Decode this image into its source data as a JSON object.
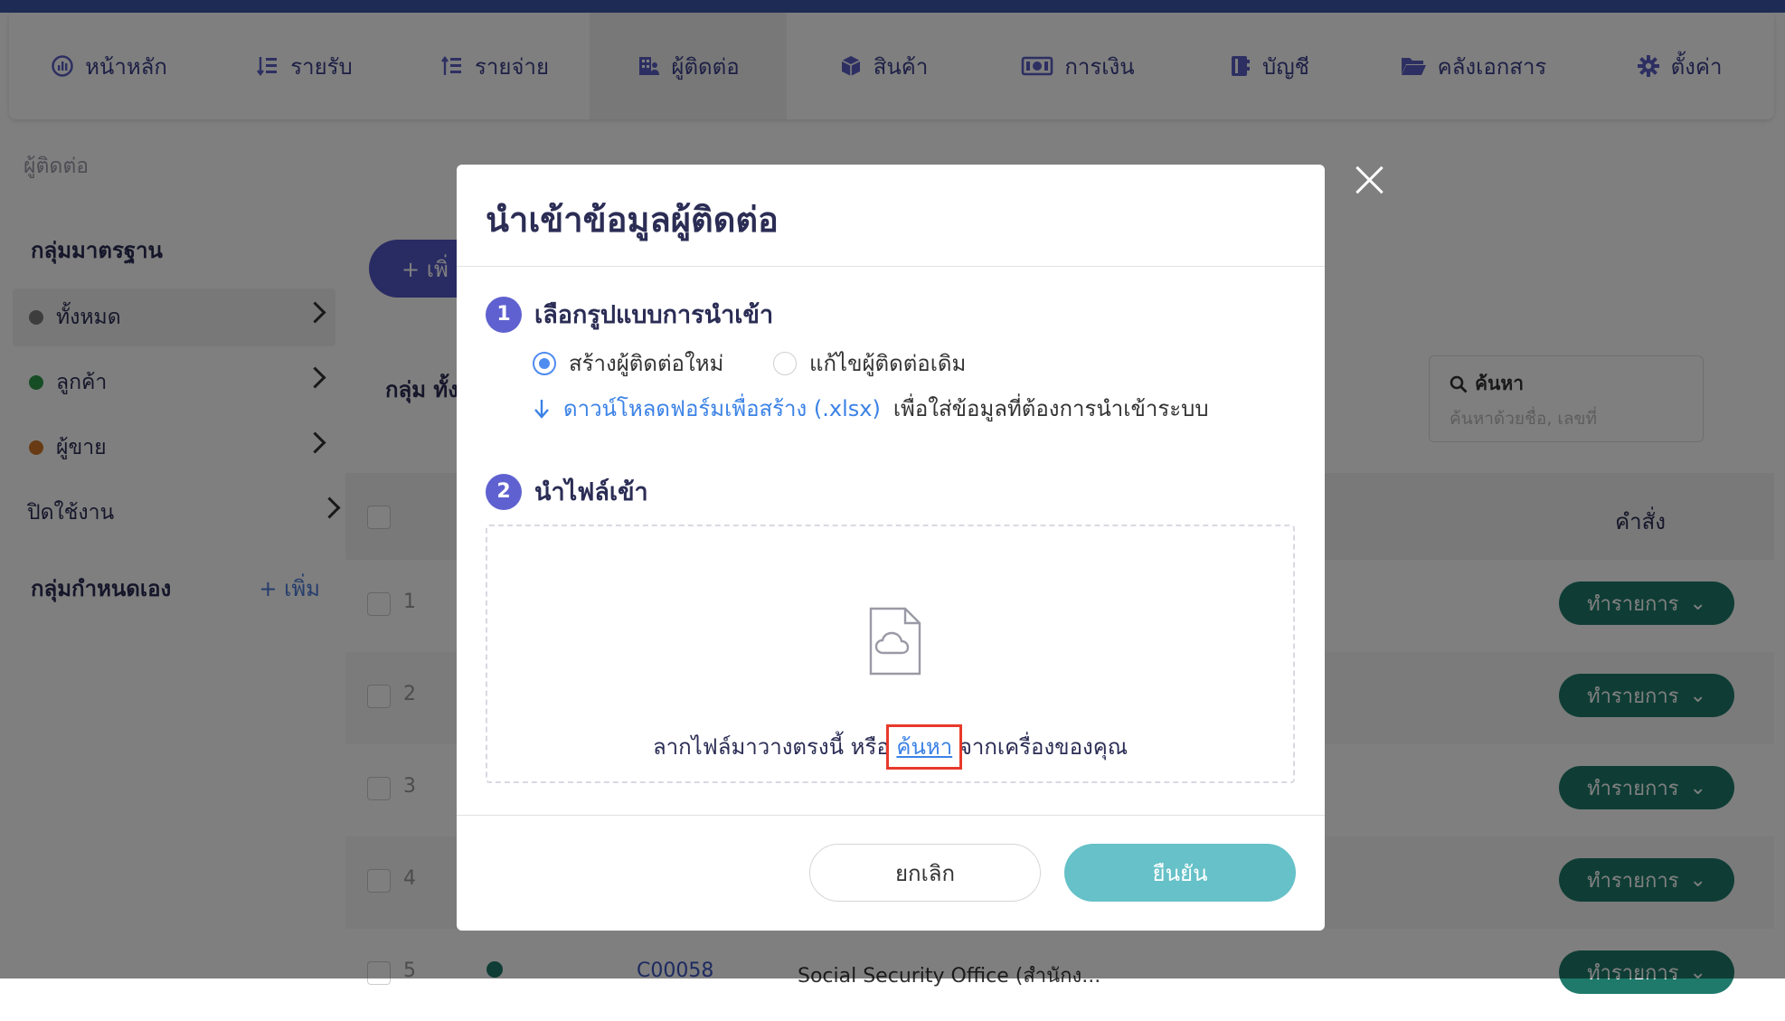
{
  "nav": {
    "items": [
      {
        "label": "หน้าหลัก",
        "icon": "dashboard-icon"
      },
      {
        "label": "รายรับ",
        "icon": "income-icon"
      },
      {
        "label": "รายจ่าย",
        "icon": "expense-icon"
      },
      {
        "label": "ผู้ติดต่อ",
        "icon": "contacts-icon"
      },
      {
        "label": "สินค้า",
        "icon": "box-icon"
      },
      {
        "label": "การเงิน",
        "icon": "money-icon"
      },
      {
        "label": "บัญชี",
        "icon": "ledger-icon"
      },
      {
        "label": "คลังเอกสาร",
        "icon": "folder-icon"
      },
      {
        "label": "ตั้งค่า",
        "icon": "gear-icon"
      }
    ],
    "active": "ผู้ติดต่อ"
  },
  "breadcrumb": "ผู้ติดต่อ",
  "sidebar": {
    "standard_title": "กลุ่มมาตรฐาน",
    "items": [
      {
        "label": "ทั้งหมด",
        "dot_color": "#7a7a7a"
      },
      {
        "label": "ลูกค้า",
        "dot_color": "#2e9a4a"
      },
      {
        "label": "ผู้ขาย",
        "dot_color": "#d0772a"
      },
      {
        "label": "ปิดใช้งาน",
        "dot_color": ""
      }
    ],
    "custom_title": "กลุ่มกำหนดเอง",
    "add_label": "+ เพิ่ม"
  },
  "main": {
    "add_button": "+ เพิ่",
    "group_label": "กลุ่ม ทั้ง",
    "search_label": "ค้นหา",
    "search_placeholder": "ค้นหาด้วยชื่อ, เลขที่",
    "command_header": "คำสั่ง",
    "row_numbers": [
      "1",
      "2",
      "3",
      "4",
      "5"
    ],
    "action_label": "ทำรายการ",
    "row5_code": "C00058",
    "row5_name": "Social Security Office (สำนักง..."
  },
  "modal": {
    "title": "นำเข้าข้อมูลผู้ติดต่อ",
    "step1_number": "1",
    "step1_title": "เลือกรูปแบบการนำเข้า",
    "option_new": "สร้างผู้ติดต่อใหม่",
    "option_edit": "แก้ไขผู้ติดต่อเดิม",
    "selected_option": "สร้างผู้ติดต่อใหม่",
    "download_link": "ดาวน์โหลดฟอร์มเพื่อสร้าง (.xlsx)",
    "download_rest": "เพื่อใส่ข้อมูลที่ต้องการนำเข้าระบบ",
    "step2_number": "2",
    "step2_title": "นำไฟล์เข้า",
    "drop_text_before": "ลากไฟล์มาวางตรงนี้ หรือ",
    "drop_link": "ค้นหา",
    "drop_text_after": "จากเครื่องของคุณ",
    "cancel_label": "ยกเลิก",
    "confirm_label": "ยืนยัน"
  },
  "colors": {
    "accent": "#5f61d0",
    "link": "#3b82e6",
    "confirm": "#66c1c8",
    "action": "#1f7a6b",
    "highlight": "#e8392b"
  }
}
